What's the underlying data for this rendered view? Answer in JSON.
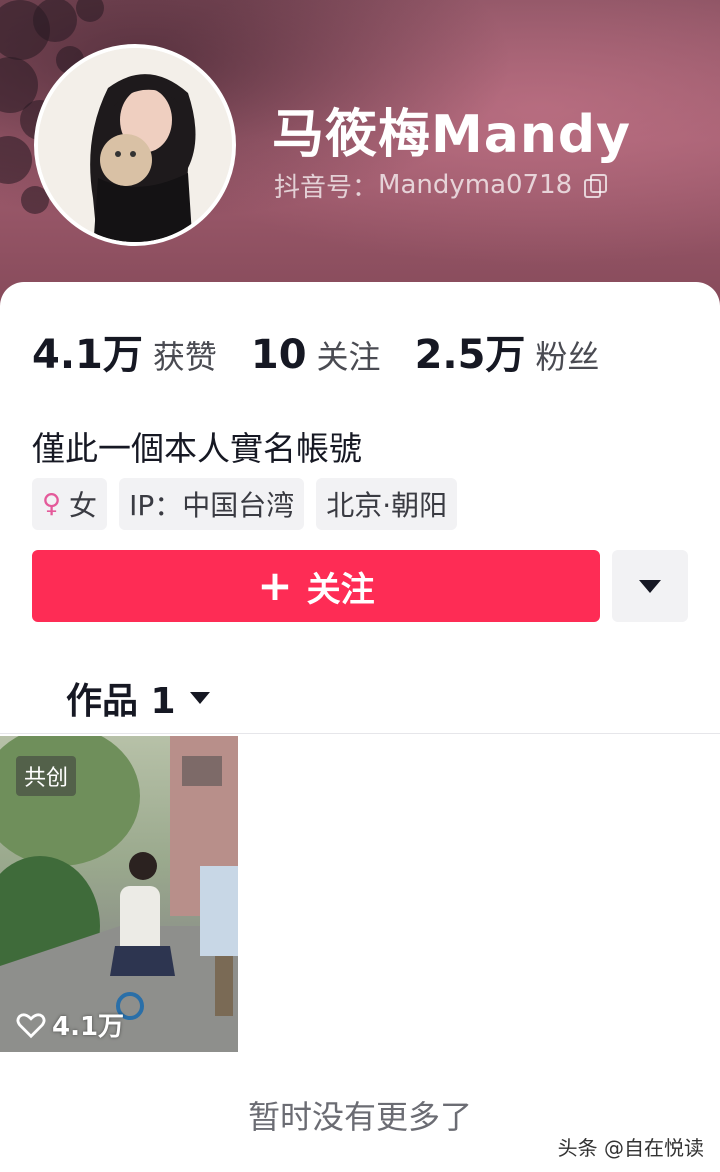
{
  "profile": {
    "name": "马筱梅Mandy",
    "douyin_id_label": "抖音号：",
    "douyin_id": "Mandyma0718"
  },
  "stats": [
    {
      "value": "4.1万",
      "label": "获赞"
    },
    {
      "value": "10",
      "label": "关注"
    },
    {
      "value": "2.5万",
      "label": "粉丝"
    }
  ],
  "bio": "僅此一個本人實名帳號",
  "tags": {
    "gender": "女",
    "ip": "IP：中国台湾",
    "location": "北京·朝阳"
  },
  "actions": {
    "follow_label": "关注",
    "more_icon": "caret-down-icon"
  },
  "tab": {
    "label": "作品 1"
  },
  "video": {
    "badge": "共创",
    "likes": "4.1万"
  },
  "footer": {
    "no_more": "暂时没有更多了",
    "watermark": "头条 @自在悦读"
  },
  "colors": {
    "accent": "#fe2c55",
    "banner": "#a25e70"
  }
}
